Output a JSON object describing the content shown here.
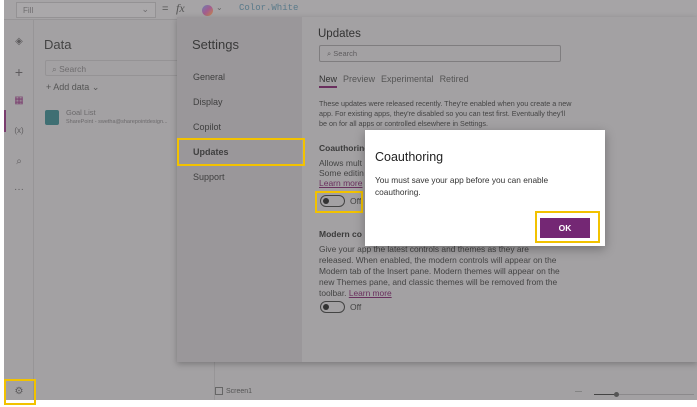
{
  "topbar": {
    "property": "Fill",
    "equals": "=",
    "fx": "fx",
    "formula": "Color.White",
    "chevron": "⌄"
  },
  "rail": {
    "icons": [
      "layers-icon",
      "plus-icon",
      "grid-icon",
      "variables-icon",
      "search-icon",
      "more-icon",
      "settings-icon"
    ],
    "variables_glyph": "(x)",
    "more_glyph": "···"
  },
  "data_panel": {
    "title": "Data",
    "search_placeholder": "Search",
    "add_data": "Add data",
    "source": {
      "name": "Goal List",
      "detail": "SharePoint - swetha@sharepointdesign..."
    }
  },
  "settings": {
    "title": "Settings",
    "nav": [
      "General",
      "Display",
      "Copilot",
      "Updates",
      "Support"
    ],
    "selected": "Updates"
  },
  "updates": {
    "title": "Updates",
    "search_placeholder": "Search",
    "tabs": [
      "New",
      "Preview",
      "Experimental",
      "Retired"
    ],
    "active_tab": "New",
    "intro": "These updates were released recently. They're enabled when you create a new app. For existing apps, they're disabled so you can test first. Eventually they'll be on for all apps or controlled elsewhere in Settings.",
    "coauthoring": {
      "title": "Coauthoring",
      "line1": "Allows mult",
      "line2": "Some editin",
      "learn_more": "Learn more",
      "toggle": "Off",
      "enabled": false
    },
    "modern": {
      "title": "Modern co",
      "desc": "Give your app the latest controls and themes as they are released. When enabled, the modern controls will appear on the Modern tab of the Insert pane. Modern themes will appear on the new Themes pane, and classic themes will be removed from the toolbar.",
      "learn_more": "Learn more",
      "toggle": "Off",
      "enabled": false
    }
  },
  "dialog": {
    "title": "Coauthoring",
    "message": "You must save your app before you can enable coauthoring.",
    "ok": "OK"
  },
  "status": {
    "screen": "Screen1",
    "zoom_minus": "—"
  },
  "colors": {
    "accent": "#742774",
    "highlight": "#f2c200"
  }
}
